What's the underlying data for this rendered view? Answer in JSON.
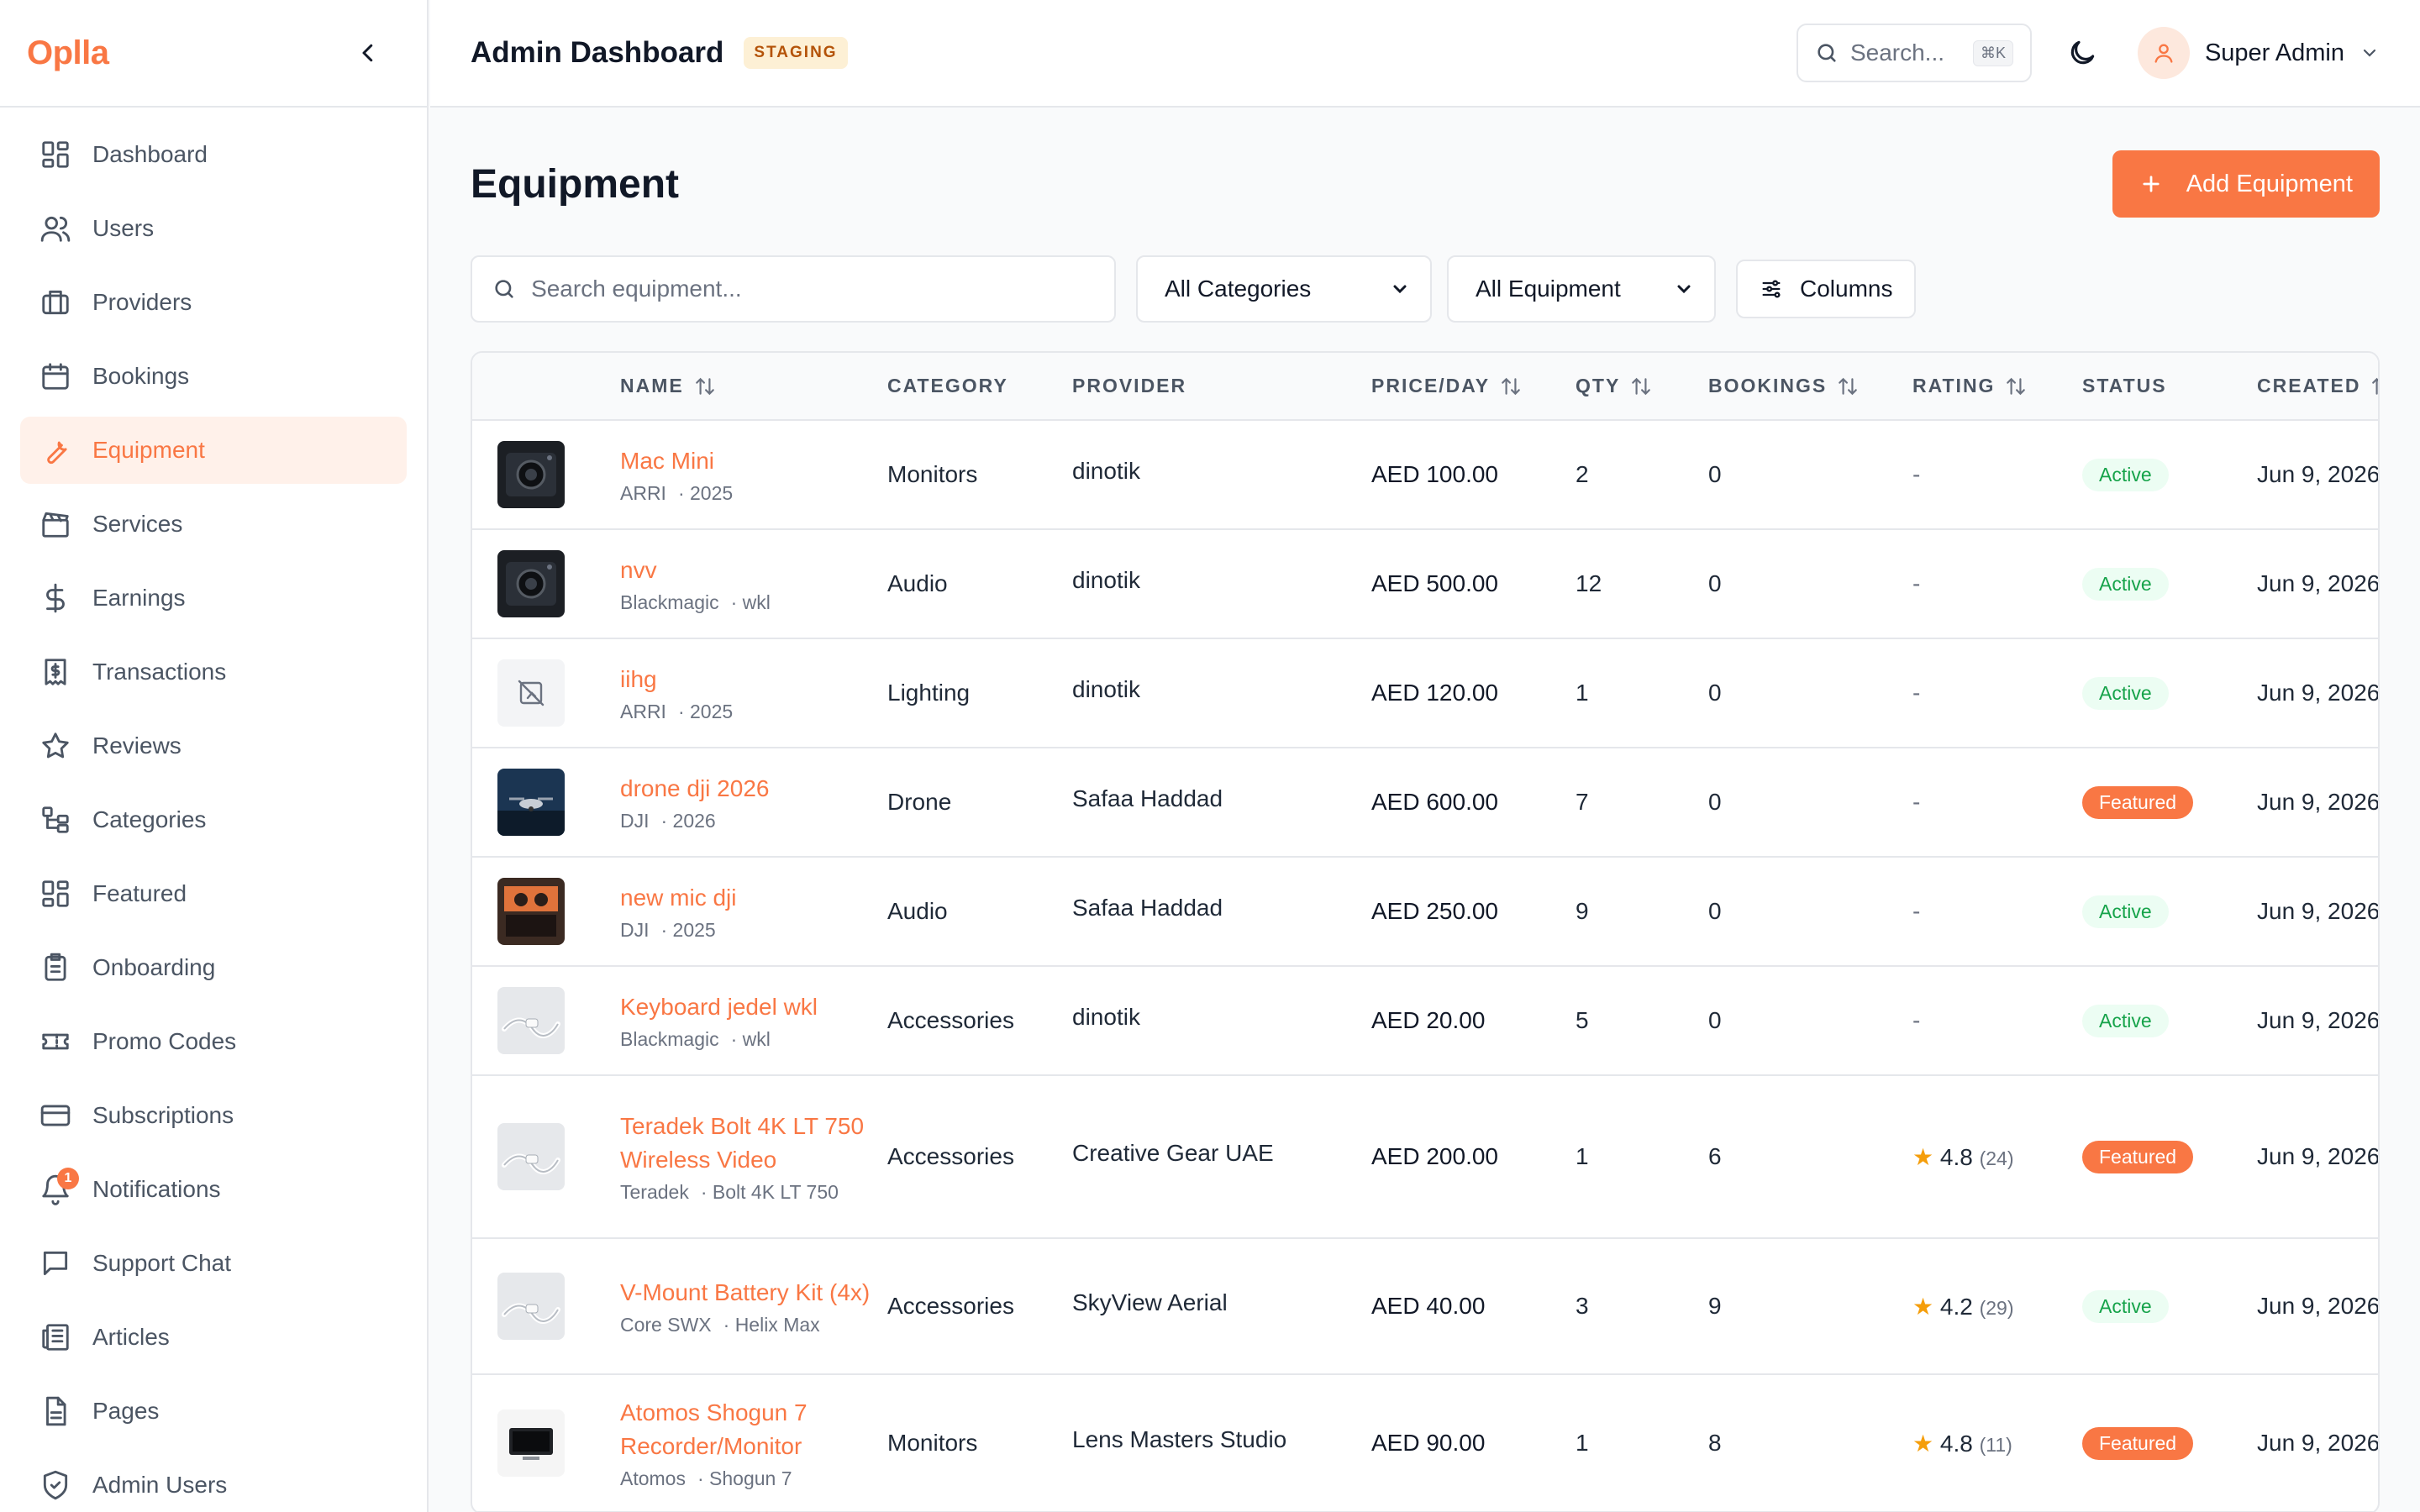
{
  "brand": "Oplla",
  "header": {
    "title": "Admin Dashboard",
    "badge": "STAGING",
    "search_placeholder": "Search...",
    "search_kbd": "⌘K",
    "user_name": "Super Admin"
  },
  "sidebar": {
    "items": [
      {
        "label": "Dashboard",
        "icon": "grid-icon"
      },
      {
        "label": "Users",
        "icon": "users-icon"
      },
      {
        "label": "Providers",
        "icon": "briefcase-icon"
      },
      {
        "label": "Bookings",
        "icon": "calendar-icon"
      },
      {
        "label": "Equipment",
        "icon": "wrench-icon",
        "active": true
      },
      {
        "label": "Services",
        "icon": "clapperboard-icon"
      },
      {
        "label": "Earnings",
        "icon": "dollar-icon"
      },
      {
        "label": "Transactions",
        "icon": "receipt-icon"
      },
      {
        "label": "Reviews",
        "icon": "star-icon"
      },
      {
        "label": "Categories",
        "icon": "tree-icon"
      },
      {
        "label": "Featured",
        "icon": "grid-icon"
      },
      {
        "label": "Onboarding",
        "icon": "clipboard-icon"
      },
      {
        "label": "Promo Codes",
        "icon": "ticket-icon"
      },
      {
        "label": "Subscriptions",
        "icon": "card-icon"
      },
      {
        "label": "Notifications",
        "icon": "bell-icon",
        "badge": "1"
      },
      {
        "label": "Support Chat",
        "icon": "chat-icon"
      },
      {
        "label": "Articles",
        "icon": "newspaper-icon"
      },
      {
        "label": "Pages",
        "icon": "file-icon"
      },
      {
        "label": "Admin Users",
        "icon": "shield-icon"
      }
    ]
  },
  "page": {
    "title": "Equipment",
    "add_button": "Add Equipment",
    "search_placeholder": "Search equipment...",
    "category_select": "All Categories",
    "equipment_select": "All Equipment",
    "columns_button": "Columns"
  },
  "table": {
    "headers": [
      "NAME",
      "CATEGORY",
      "PROVIDER",
      "PRICE/DAY",
      "QTY",
      "BOOKINGS",
      "RATING",
      "STATUS",
      "CREATED"
    ],
    "rows": [
      {
        "name": "Mac Mini",
        "brand": "ARRI",
        "model": "· 2025",
        "category": "Monitors",
        "provider": "dinotik",
        "price": "AED 100.00",
        "qty": "2",
        "bookings": "0",
        "rating": "-",
        "rating_count": "",
        "status": "Active",
        "created": "Jun 9, 2026",
        "thumb": "camera"
      },
      {
        "name": "nvv",
        "brand": "Blackmagic",
        "model": "· wkl",
        "category": "Audio",
        "provider": "dinotik",
        "price": "AED 500.00",
        "qty": "12",
        "bookings": "0",
        "rating": "-",
        "rating_count": "",
        "status": "Active",
        "created": "Jun 9, 2026",
        "thumb": "camera"
      },
      {
        "name": "iihg",
        "brand": "ARRI",
        "model": "· 2025",
        "category": "Lighting",
        "provider": "dinotik",
        "price": "AED 120.00",
        "qty": "1",
        "bookings": "0",
        "rating": "-",
        "rating_count": "",
        "status": "Active",
        "created": "Jun 9, 2026",
        "thumb": "none"
      },
      {
        "name": "drone dji 2026",
        "brand": "DJI",
        "model": "· 2026",
        "category": "Drone",
        "provider": "Safaa Haddad",
        "price": "AED 600.00",
        "qty": "7",
        "bookings": "0",
        "rating": "-",
        "rating_count": "",
        "status": "Featured",
        "created": "Jun 9, 2026",
        "thumb": "drone"
      },
      {
        "name": "new mic dji",
        "brand": "DJI",
        "model": "· 2025",
        "category": "Audio",
        "provider": "Safaa Haddad",
        "price": "AED 250.00",
        "qty": "9",
        "bookings": "0",
        "rating": "-",
        "rating_count": "",
        "status": "Active",
        "created": "Jun 9, 2026",
        "thumb": "studio"
      },
      {
        "name": "Keyboard jedel wkl",
        "brand": "Blackmagic",
        "model": "· wkl",
        "category": "Accessories",
        "provider": "dinotik",
        "price": "AED 20.00",
        "qty": "5",
        "bookings": "0",
        "rating": "-",
        "rating_count": "",
        "status": "Active",
        "created": "Jun 9, 2026",
        "thumb": "cable"
      },
      {
        "name": "Teradek Bolt 4K LT 750 Wireless Video",
        "brand": "Teradek",
        "model": "· Bolt 4K LT 750",
        "category": "Accessories",
        "provider": "Creative Gear UAE",
        "price": "AED 200.00",
        "qty": "1",
        "bookings": "6",
        "rating": "4.8",
        "rating_count": "(24)",
        "status": "Featured",
        "created": "Jun 9, 2026",
        "thumb": "cable"
      },
      {
        "name": "V-Mount Battery Kit (4x)",
        "brand": "Core SWX",
        "model": "· Helix Max",
        "category": "Accessories",
        "provider": "SkyView Aerial",
        "price": "AED 40.00",
        "qty": "3",
        "bookings": "9",
        "rating": "4.2",
        "rating_count": "(29)",
        "status": "Active",
        "created": "Jun 9, 2026",
        "thumb": "cable"
      },
      {
        "name": "Atomos Shogun 7 Recorder/Monitor",
        "brand": "Atomos",
        "model": "· Shogun 7",
        "category": "Monitors",
        "provider": "Lens Masters Studio",
        "price": "AED 90.00",
        "qty": "1",
        "bookings": "8",
        "rating": "4.8",
        "rating_count": "(11)",
        "status": "Featured",
        "created": "Jun 9, 2026",
        "thumb": "monitor"
      }
    ]
  },
  "colors": {
    "accent": "#f97744",
    "active_green": "#16a34a"
  }
}
